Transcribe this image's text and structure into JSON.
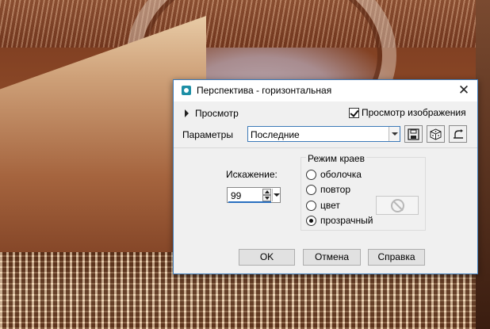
{
  "dialog": {
    "title": "Перспектива - горизонтальная",
    "preview_toggle_label": "Просмотр",
    "preview_image_label": "Просмотр изображения",
    "preview_image_checked": true,
    "params_label": "Параметры",
    "preset_value": "Последние",
    "distortion_label": "Искажение:",
    "distortion_value": "99",
    "edge_mode": {
      "legend": "Режим краев",
      "options": [
        {
          "label": "оболочка",
          "selected": false
        },
        {
          "label": "повтор",
          "selected": false
        },
        {
          "label": "цвет",
          "selected": false
        },
        {
          "label": "прозрачный",
          "selected": true
        }
      ]
    },
    "buttons": {
      "ok": "OK",
      "cancel": "Отмена",
      "help": "Справка"
    },
    "icons": {
      "app": "camera-icon",
      "close": "close-icon",
      "save_preset": "save-icon",
      "randomize": "dice-icon",
      "reset": "reset-arrow-icon",
      "no_color": "no-symbol-icon"
    },
    "colors": {
      "accent_border": "#3d7ab8",
      "dialog_bg": "#f0f0f0"
    }
  }
}
